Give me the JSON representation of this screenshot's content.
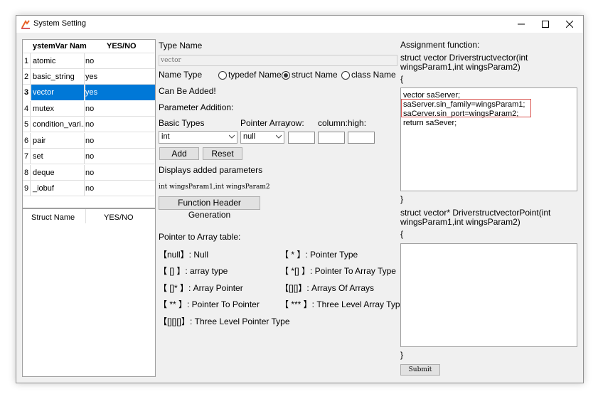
{
  "window": {
    "title": "System Setting"
  },
  "sysvar_grid": {
    "headers": [
      "ystemVar Nam",
      "YES/NO"
    ],
    "rows": [
      {
        "num": "1",
        "name": "atomic",
        "value": "no"
      },
      {
        "num": "2",
        "name": "basic_string",
        "value": "yes"
      },
      {
        "num": "3",
        "name": "vector",
        "value": "yes"
      },
      {
        "num": "4",
        "name": "mutex",
        "value": "no"
      },
      {
        "num": "5",
        "name": "condition_vari...",
        "value": "no"
      },
      {
        "num": "6",
        "name": "pair",
        "value": "no"
      },
      {
        "num": "7",
        "name": "set",
        "value": "no"
      },
      {
        "num": "8",
        "name": "deque",
        "value": "no"
      },
      {
        "num": "9",
        "name": "_iobuf",
        "value": "no"
      }
    ]
  },
  "struct_grid": {
    "headers": [
      "Struct Name",
      "YES/NO"
    ]
  },
  "form": {
    "type_name_label": "Type Name",
    "type_name_value": "vector",
    "name_type_label": "Name Type",
    "radio_typedef": "typedef Name",
    "radio_struct": "struct Name",
    "radio_class": "class Name",
    "can_be_added": "Can Be Added!",
    "param_addition": "Parameter Addition:",
    "basic_types_label": "Basic Types",
    "pointer_array_label": "Pointer Array",
    "row_label": "row:",
    "column_label": "column:",
    "high_label": "high:",
    "basic_type_value": "int",
    "pointer_value": "null",
    "add_button": "Add",
    "reset_button": "Reset",
    "displays_added": "Displays added parameters",
    "added_params": "int wingsParam1,int wingsParam2",
    "func_header_button": "Function Header Generation"
  },
  "pointer_table": {
    "title": "Pointer to Array table:",
    "items": [
      "【null】: Null",
      "【 * 】: Pointer Type",
      "【 [] 】: array type",
      "【 *[] 】: Pointer To Array Type",
      "【 []* 】: Array Pointer",
      "【[][]】: Arrays Of Arrays",
      "【 ** 】: Pointer To Pointer",
      "【 *** 】: Three Level Array Type",
      "【[][][]】: Three Level Pointer Type"
    ]
  },
  "assignment": {
    "label": "Assignment function:",
    "sig1_line1": "struct vector Driverstructvector(int",
    "sig1_line2": "wingsParam1,int wingsParam2)",
    "open_brace": "{",
    "code_lines": [
      "vector saServer;",
      "saServer.sin_family=wingsParam1;",
      "saCerver.sin_port=wingsParam2;",
      "return saSever;"
    ],
    "close_brace": "}",
    "sig2_line1": "struct vector* DriverstructvectorPoint(int",
    "sig2_line2": "wingsParam1,int wingsParam2)",
    "open_brace2": "{",
    "close_brace2": "}",
    "submit_button": "Submit"
  }
}
